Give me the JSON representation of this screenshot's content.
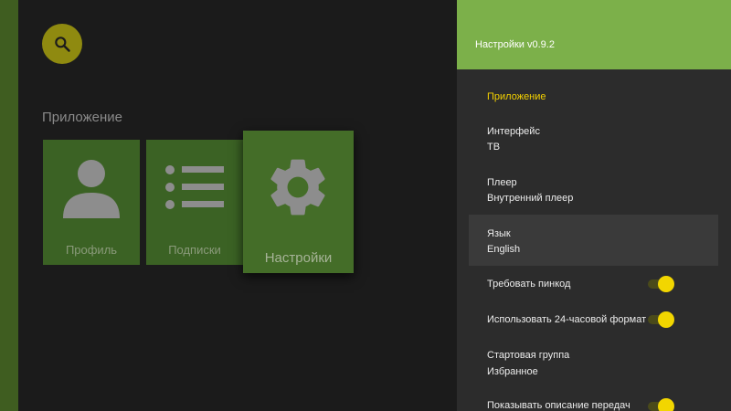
{
  "main": {
    "search_icon": "search-icon",
    "section_title": "Приложение",
    "tiles": [
      {
        "label": "Профиль",
        "icon": "person-icon"
      },
      {
        "label": "Подписки",
        "icon": "list-icon"
      },
      {
        "label": "Настройки",
        "icon": "gear-icon"
      }
    ]
  },
  "panel": {
    "title": "Настройки v0.9.2",
    "section": "Приложение",
    "items": [
      {
        "title": "Интерфейс",
        "value": "ТВ"
      },
      {
        "title": "Плеер",
        "value": "Внутренний плеер"
      },
      {
        "title": "Язык",
        "value": "English"
      },
      {
        "title": "Требовать пинкод",
        "switch_on": true
      },
      {
        "title": "Использовать 24-часовой формат",
        "switch_on": true
      },
      {
        "title": "Стартовая группа",
        "value": "Избранное"
      },
      {
        "title": "Показывать описание передач",
        "switch_on": true
      }
    ]
  },
  "colors": {
    "header_bg": "#7cb04a",
    "accent_yellow": "#f5d200",
    "tile_green": "#3b6224",
    "panel_bg": "#2c2c2c"
  }
}
